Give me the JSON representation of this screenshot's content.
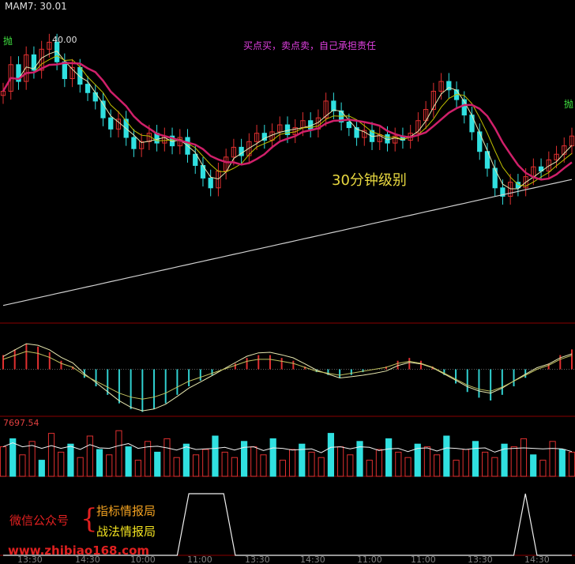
{
  "chart_data": {
    "type": "candlestick",
    "top_label": "MAM7: 30.01",
    "annotations": {
      "slogan": "买点买，卖点卖，自己承担责任",
      "level": "30分钟级别",
      "sell": "抛",
      "price_marker": "40.00"
    },
    "x_ticks": [
      "13:30",
      "14:30",
      "10:00",
      "11:00",
      "13:30",
      "14:30",
      "11:00",
      "11:00",
      "13:30",
      "14:30"
    ],
    "price_panel": {
      "ylim": [
        20,
        42
      ],
      "closes": [
        36.5,
        38.4,
        37.2,
        39.1,
        38.0,
        39.5,
        40.0,
        38.6,
        37.4,
        38.2,
        37.0,
        36.4,
        35.8,
        34.6,
        33.8,
        34.5,
        33.2,
        32.4,
        32.9,
        33.5,
        32.8,
        33.3,
        32.6,
        33.2,
        32.0,
        31.2,
        30.3,
        29.6,
        30.8,
        31.8,
        32.5,
        31.9,
        32.9,
        33.5,
        33.0,
        33.6,
        34.1,
        33.4,
        33.9,
        34.4,
        33.8,
        34.6,
        35.8,
        35.1,
        34.3,
        33.9,
        33.2,
        33.7,
        32.9,
        33.4,
        32.8,
        33.3,
        33.0,
        33.5,
        34.4,
        35.2,
        36.5,
        37.2,
        36.6,
        35.9,
        34.8,
        33.6,
        32.2,
        31.0,
        29.6,
        29.0,
        30.0,
        29.6,
        30.4,
        31.1,
        30.8,
        31.6,
        32.0,
        32.6,
        33.3
      ],
      "ma_fast_color": "#e8e8b0",
      "ma_mid_color": "#c0c000",
      "ma_slow_color": "#d0206a",
      "long_ma_color": "#d0d0d0",
      "up_color": "#e03030",
      "down_color": "#30e0e0"
    },
    "macd_panel": {
      "histogram": [
        0.5,
        0.7,
        0.9,
        0.8,
        0.6,
        0.3,
        0.1,
        -0.3,
        -0.6,
        -0.9,
        -1.2,
        -1.4,
        -1.5,
        -1.4,
        -1.2,
        -0.9,
        -0.6,
        -0.4,
        -0.2,
        0.0,
        0.2,
        0.4,
        0.5,
        0.5,
        0.4,
        0.3,
        0.1,
        -0.1,
        -0.2,
        -0.3,
        -0.2,
        -0.1,
        0.0,
        0.1,
        0.3,
        0.4,
        0.3,
        0.1,
        -0.2,
        -0.5,
        -0.8,
        -1.0,
        -1.1,
        -0.9,
        -0.6,
        -0.3,
        0.0,
        0.2,
        0.5,
        0.7
      ],
      "ylim": [
        -1.6,
        1.6
      ]
    },
    "volume_panel": {
      "label": "7697.54",
      "values": [
        55,
        70,
        40,
        65,
        30,
        80,
        45,
        60,
        35,
        75,
        50,
        40,
        85,
        55,
        30,
        65,
        45,
        70,
        35,
        60,
        40,
        50,
        75,
        45,
        35,
        65,
        55,
        40,
        70,
        30,
        50,
        60,
        45,
        35,
        80,
        55,
        40,
        65,
        30,
        50,
        70,
        45,
        35,
        60,
        55,
        40,
        75,
        30,
        50,
        65,
        45,
        35,
        60,
        55,
        70,
        40,
        30,
        65,
        50,
        45
      ],
      "ylim": [
        0,
        100
      ]
    },
    "signal_panel": {
      "values": [
        0,
        0,
        0,
        0,
        0,
        0,
        0,
        0,
        0,
        0,
        0,
        0,
        0,
        0,
        0,
        0,
        1,
        1,
        1,
        1,
        0,
        0,
        0,
        0,
        0,
        0,
        0,
        0,
        0,
        0,
        0,
        0,
        0,
        0,
        0,
        0,
        0,
        0,
        0,
        0,
        0,
        0,
        0,
        0,
        0,
        1,
        0,
        0,
        0,
        0
      ],
      "ylim": [
        0,
        1
      ],
      "color": "#f0f0f0"
    }
  },
  "watermark": {
    "wechat": "微信公众号",
    "account1": "指标情报局",
    "account2": "战法情报局",
    "site": "www.zhibiao168.com"
  }
}
